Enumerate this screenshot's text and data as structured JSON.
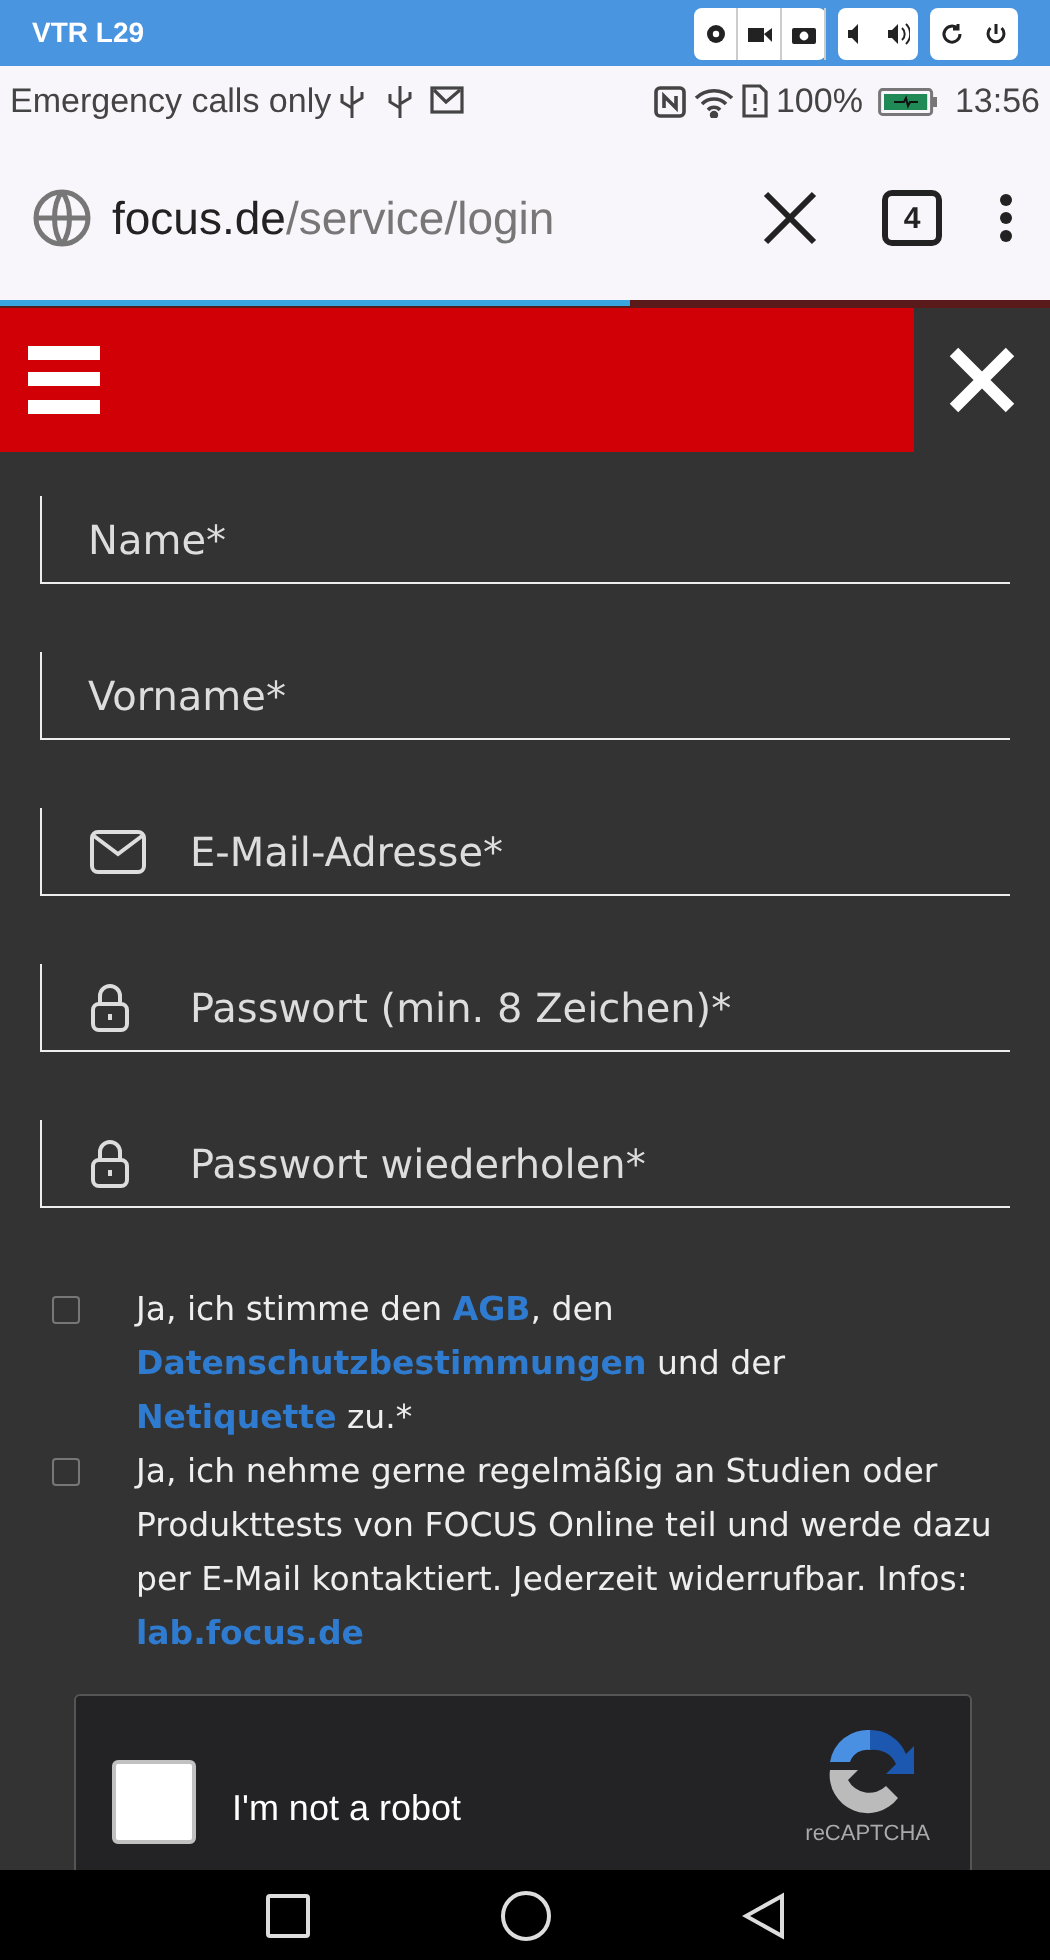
{
  "device_bar": {
    "title": "VTR L29"
  },
  "status_bar": {
    "carrier": "Emergency calls only",
    "battery": "100%",
    "time": "13:56"
  },
  "browser": {
    "url_host": "focus.de",
    "url_path": "/service/login",
    "tab_count": "4"
  },
  "form": {
    "fields": [
      {
        "placeholder": "Name*",
        "kind": "text"
      },
      {
        "placeholder": "Vorname*",
        "kind": "text"
      },
      {
        "placeholder": "E-Mail-Adresse*",
        "kind": "email"
      },
      {
        "placeholder": "Passwort (min. 8 Zeichen)*",
        "kind": "password"
      },
      {
        "placeholder": "Passwort wiederholen*",
        "kind": "password"
      }
    ],
    "consents": [
      {
        "checked": false,
        "segments": [
          {
            "kind": "plain",
            "text": "Ja, ich stimme den "
          },
          {
            "kind": "link",
            "text": "AGB"
          },
          {
            "kind": "plain",
            "text": ", den "
          },
          {
            "kind": "link",
            "text": "Datenschutzbestimmungen"
          },
          {
            "kind": "plain",
            "text": " und der "
          },
          {
            "kind": "link",
            "text": "Netiquette"
          },
          {
            "kind": "plain",
            "text": " zu.*"
          }
        ]
      },
      {
        "checked": false,
        "segments": [
          {
            "kind": "plain",
            "text": "Ja, ich nehme gerne regelmäßig an Studien oder Produkttests von FOCUS Online teil und werde dazu per E-Mail kontaktiert. Jederzeit widerrufbar. Infos: "
          },
          {
            "kind": "link",
            "text": "lab.focus.de"
          }
        ]
      }
    ],
    "captcha": {
      "label": "I'm not a robot",
      "checked": false,
      "brand": "reCAPTCHA"
    }
  }
}
